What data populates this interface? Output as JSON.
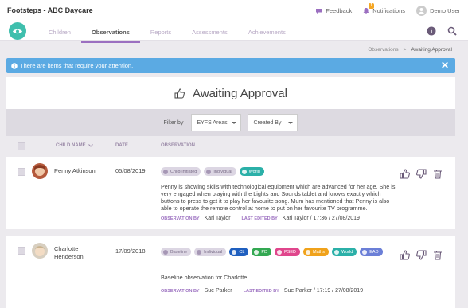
{
  "app": {
    "title": "Footsteps - ABC Daycare"
  },
  "topbar": {
    "feedback": "Feedback",
    "notifications": "Notifications",
    "notification_count": "1",
    "user": "Demo User"
  },
  "nav": {
    "tabs": [
      "Children",
      "Observations",
      "Reports",
      "Assessments",
      "Achievements"
    ],
    "active_tab": "Observations"
  },
  "breadcrumb": {
    "parent": "Observations",
    "separator": ">",
    "current": "Awaiting Approval"
  },
  "alert": {
    "text": "There are items that require your attention.",
    "close": "✕"
  },
  "page": {
    "title": "Awaiting Approval"
  },
  "filters": {
    "label": "Filter by",
    "area": "EYFS Areas",
    "created_by": "Created By"
  },
  "table": {
    "col_name": "CHILD NAME",
    "col_date": "DATE",
    "col_obs": "OBSERVATION"
  },
  "observations": [
    {
      "child": "Penny Atkinson",
      "date": "05/08/2019",
      "tags": [
        {
          "label": "Child-initiated",
          "style": "grey"
        },
        {
          "label": "Individual",
          "style": "grey"
        },
        {
          "label": "World",
          "color": "#2bb0a8"
        }
      ],
      "text": "Penny is showing skills with technological equipment which are advanced for her age. She is very engaged when playing with the Lights and Sounds tablet and knows exactly which buttons to press to get it to play her favourite song. Mum has mentioned that Penny is also able to operate the remote control at home to put on her favourite TV programme.",
      "observation_by_label": "OBSERVATION BY",
      "observation_by": "Karl Taylor",
      "last_edited_label": "LAST EDITED BY",
      "last_edited": "Karl Taylor / 17:36 / 27/08/2019"
    },
    {
      "child_line1": "Charlotte",
      "child_line2": "Henderson",
      "date": "17/09/2018",
      "tags": [
        {
          "label": "Baseline",
          "style": "grey"
        },
        {
          "label": "Individual",
          "style": "grey"
        },
        {
          "label": "CL",
          "color": "#1f5fbf"
        },
        {
          "label": "PD",
          "color": "#33a852"
        },
        {
          "label": "PSED",
          "color": "#e0468c"
        },
        {
          "label": "Maths",
          "color": "#f0a21b"
        },
        {
          "label": "World",
          "color": "#2bb0a8"
        },
        {
          "label": "EAD",
          "color": "#6b7fd7"
        }
      ],
      "text": "Baseline observation for Charlotte",
      "observation_by_label": "OBSERVATION BY",
      "observation_by": "Sue Parker",
      "last_edited_label": "LAST EDITED BY",
      "last_edited": "Sue Parker / 17:19 / 27/08/2019"
    }
  ],
  "colors": {
    "accent": "#9b6fc0",
    "logo": "#3fbfad",
    "alert": "#5baae3"
  }
}
